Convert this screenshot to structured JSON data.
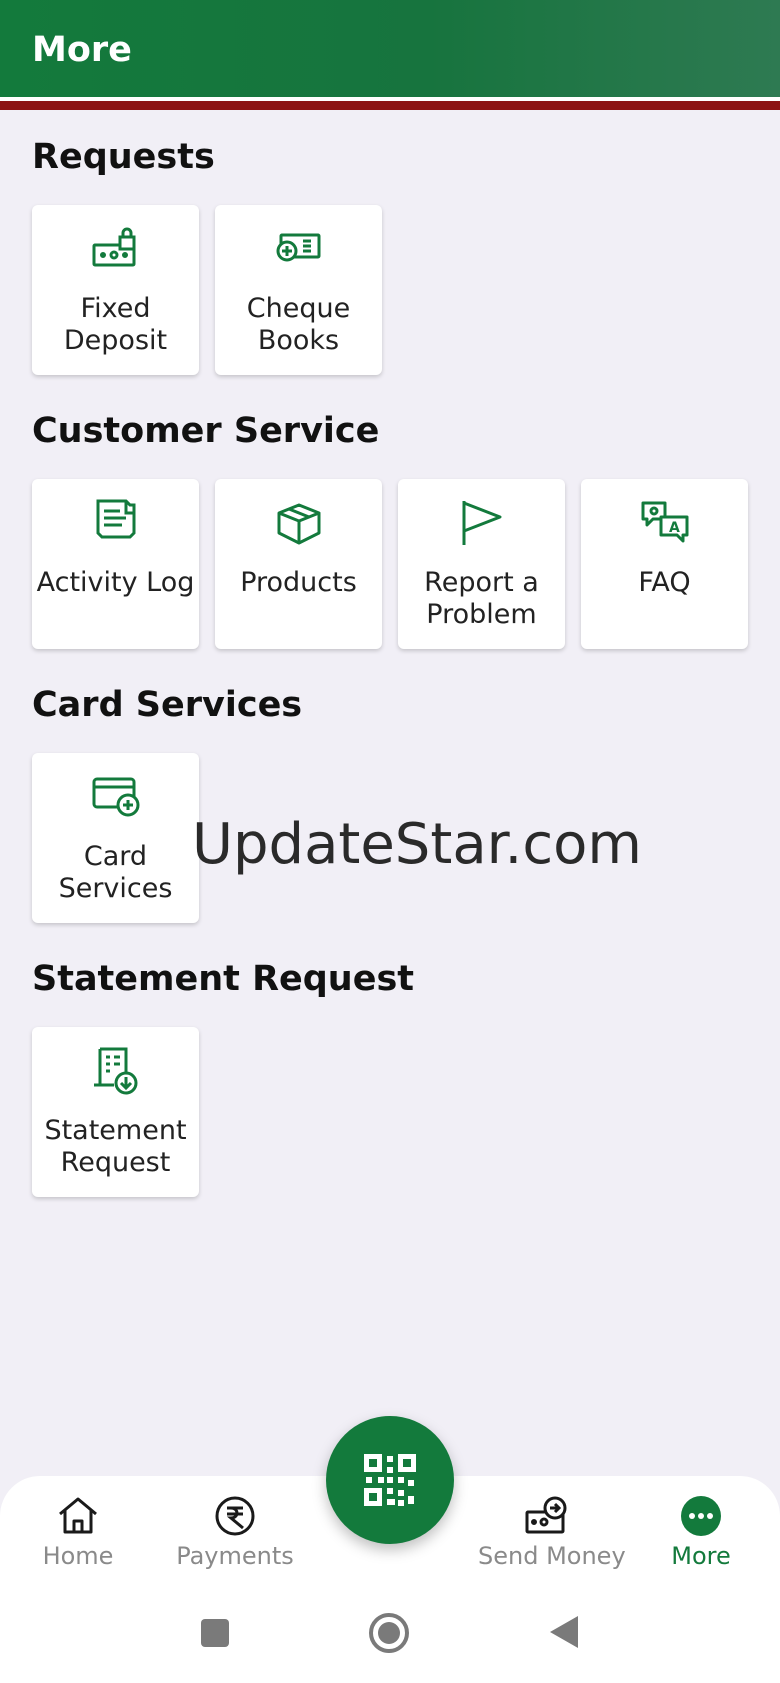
{
  "header": {
    "title": "More"
  },
  "sections": {
    "requests": {
      "title": "Requests",
      "items": [
        {
          "label": "Fixed Deposit",
          "icon": "fixed-deposit-icon"
        },
        {
          "label": "Cheque Books",
          "icon": "cheque-book-icon"
        }
      ]
    },
    "customer_service": {
      "title": "Customer Service",
      "items": [
        {
          "label": "Activity Log",
          "icon": "receipt-icon"
        },
        {
          "label": "Products",
          "icon": "box-icon"
        },
        {
          "label": "Report a Problem",
          "icon": "flag-icon"
        },
        {
          "label": "FAQ",
          "icon": "faq-icon"
        }
      ]
    },
    "card_services": {
      "title": "Card Services",
      "items": [
        {
          "label": "Card Services",
          "icon": "card-add-icon"
        }
      ]
    },
    "statement_request": {
      "title": "Statement Request",
      "items": [
        {
          "label": "Statement Request",
          "icon": "statement-download-icon"
        }
      ]
    }
  },
  "watermark": "UpdateStar.com",
  "bottom_nav": {
    "items": [
      {
        "label": "Home",
        "icon": "home-icon",
        "active": false
      },
      {
        "label": "Payments",
        "icon": "payments-icon",
        "active": false
      },
      {
        "label": "Send Money",
        "icon": "send-money-icon",
        "active": false
      },
      {
        "label": "More",
        "icon": "more-dots-icon",
        "active": true
      }
    ],
    "fab": {
      "icon": "qr-code-icon"
    }
  },
  "colors": {
    "primary": "#137a3c",
    "accent_stripe": "#8c1313",
    "background": "#f1eff6",
    "inactive_text": "#8a8a8a"
  }
}
